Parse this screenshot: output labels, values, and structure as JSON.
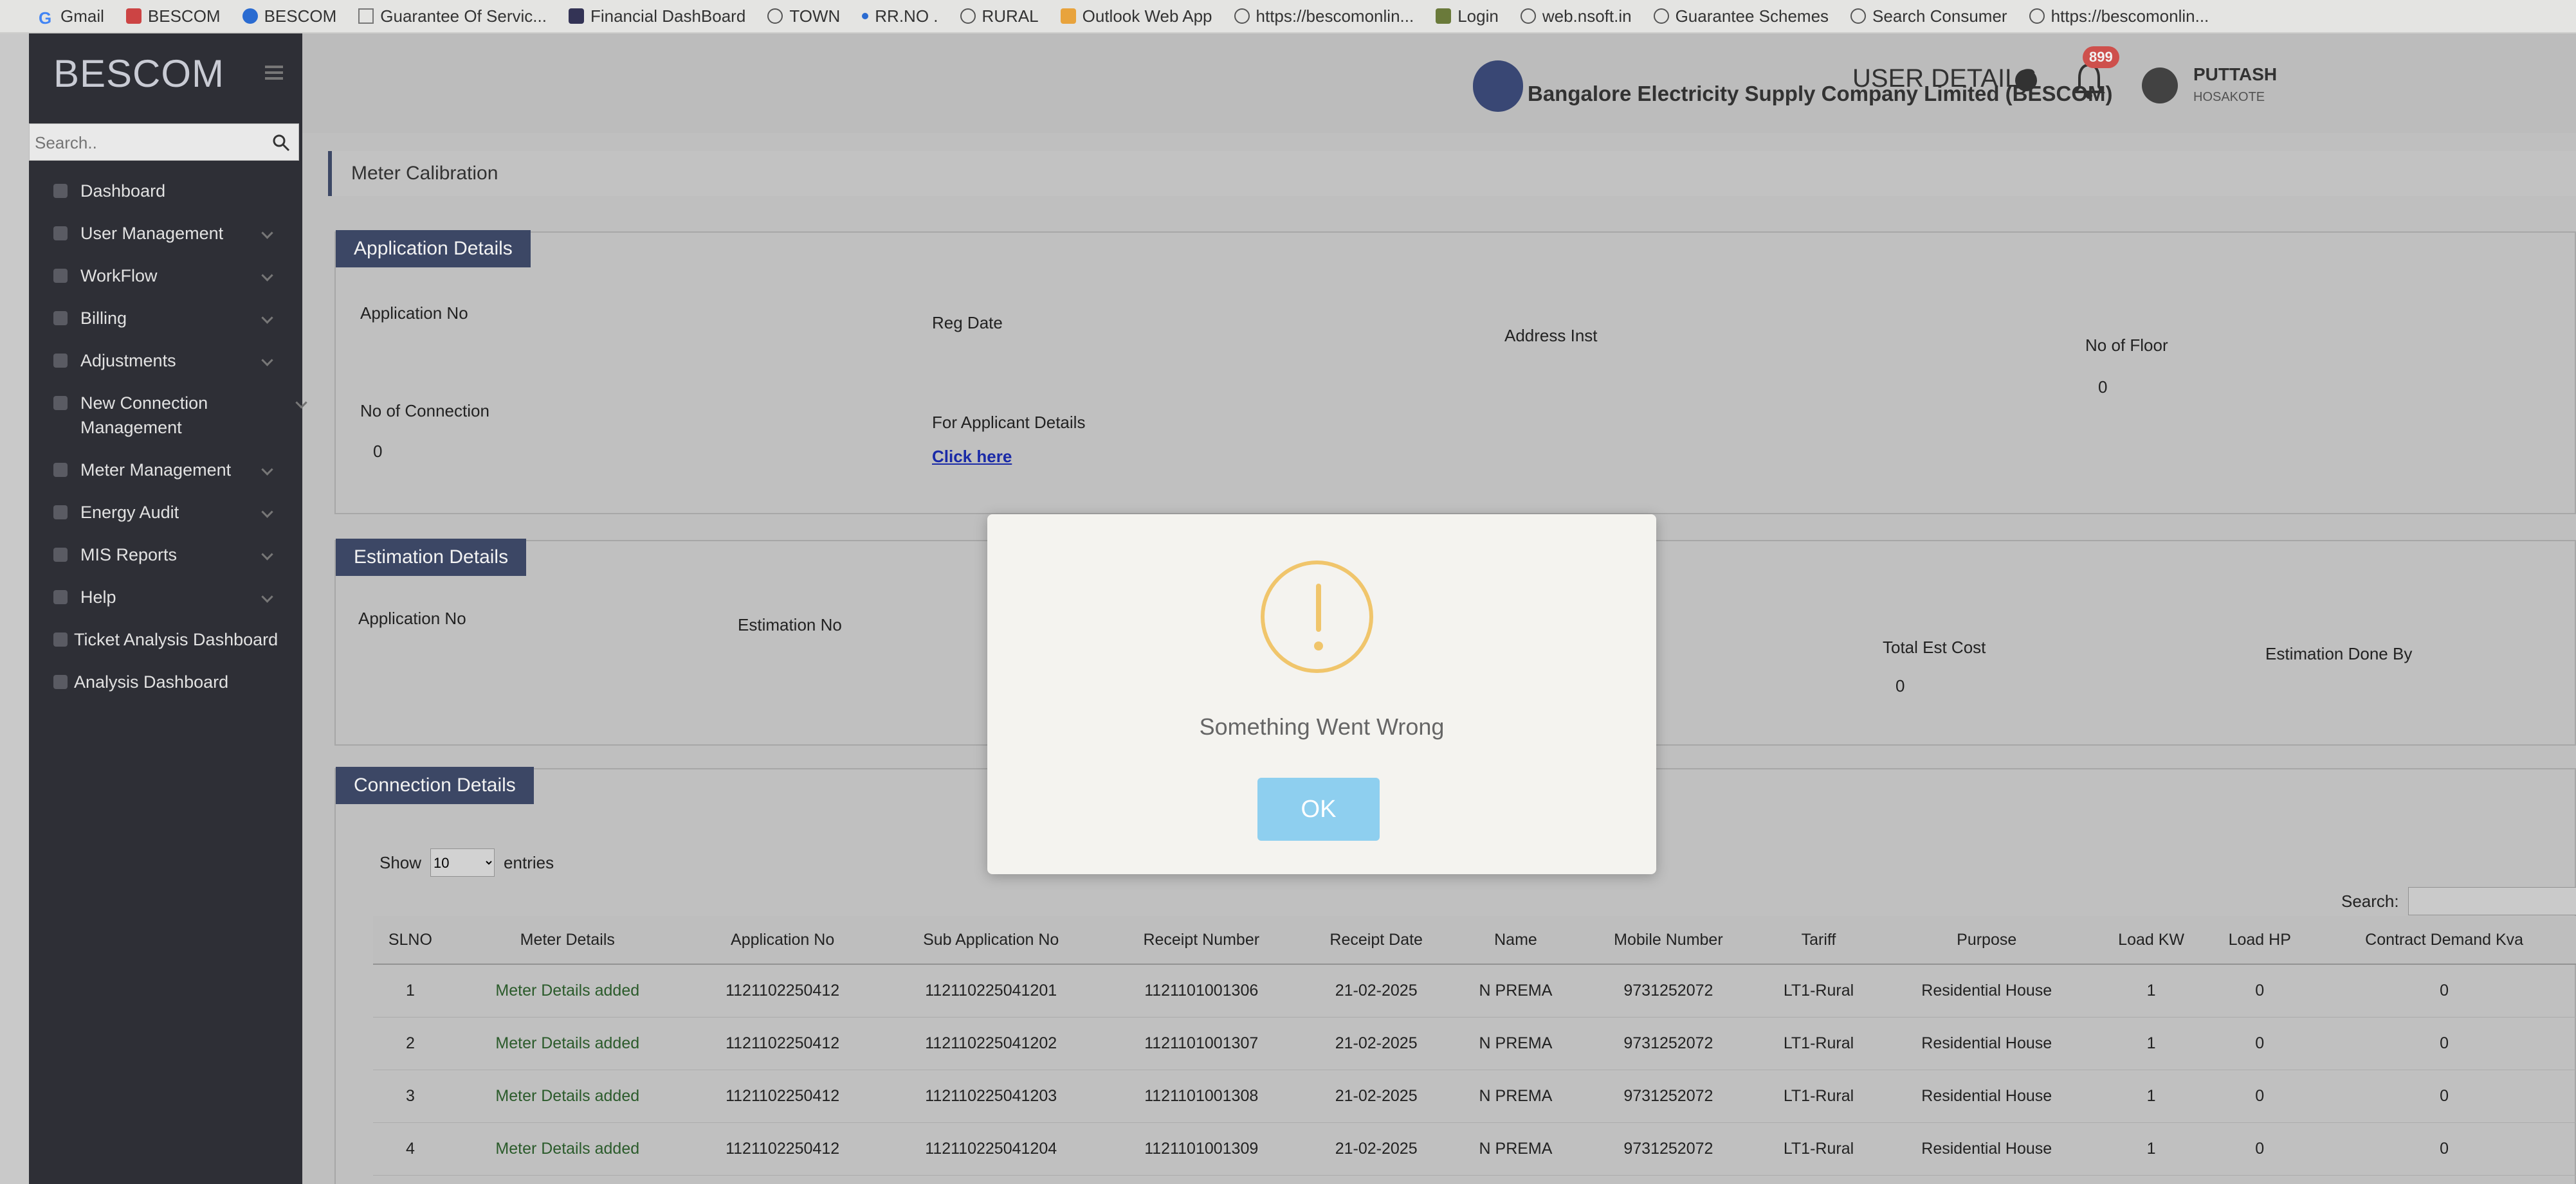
{
  "bookmarks": [
    "Gmail",
    "BESCOM",
    "BESCOM",
    "Guarantee Of Servic...",
    "Financial DashBoard",
    "TOWN",
    "RR.NO .",
    "RURAL",
    "Outlook Web App",
    "https://bescomonlin...",
    "Login",
    "web.nsoft.in",
    "Guarantee Schemes",
    "Search Consumer",
    "https://bescomonlin..."
  ],
  "sidebar": {
    "brand": "BESCOM",
    "search_placeholder": "Search..",
    "items": [
      {
        "label": "Dashboard"
      },
      {
        "label": "User Management"
      },
      {
        "label": "WorkFlow"
      },
      {
        "label": "Billing"
      },
      {
        "label": "Adjustments"
      },
      {
        "label": "New Connection Management"
      },
      {
        "label": "Meter Management"
      },
      {
        "label": "Energy Audit"
      },
      {
        "label": "MIS Reports"
      },
      {
        "label": "Help"
      },
      {
        "label": "Ticket Analysis Dashboard"
      },
      {
        "label": "Analysis Dashboard"
      }
    ]
  },
  "header": {
    "company": "Bangalore Electricity Supply Company Limited (BESCOM)",
    "user_details": "USER DETAILS",
    "notifications": "899",
    "user_name": "PUTTASH",
    "user_location": "HOSAKOTE"
  },
  "breadcrumb": "Meter Calibration",
  "application": {
    "title": "Application Details",
    "application_no_label": "Application No",
    "reg_date_label": "Reg Date",
    "address_label": "Address Inst",
    "floors_label": "No of Floor",
    "floors_value": "0",
    "connections_label": "No of Connection",
    "connections_value": "0",
    "applicant_label": "For Applicant Details",
    "click_here": "Click here"
  },
  "estimation": {
    "title": "Estimation Details",
    "application_no_label": "Application No",
    "estimation_no_label": "Estimation No",
    "total_cost_label": "Total Est Cost",
    "total_cost_value": "0",
    "done_by_label": "Estimation Done By"
  },
  "connection": {
    "title": "Connection Details",
    "show_label": "Show",
    "show_value": "10",
    "entries_label": "entries",
    "search_label": "Search:",
    "columns": [
      "SLNO",
      "Meter Details",
      "Application No",
      "Sub Application No",
      "Receipt Number",
      "Receipt Date",
      "Name",
      "Mobile Number",
      "Tariff",
      "Purpose",
      "Load KW",
      "Load HP",
      "Contract Demand Kva"
    ],
    "rows": [
      [
        "1",
        "Meter Details added",
        "1121102250412",
        "112110225041201",
        "1121101001306",
        "21-02-2025",
        "N PREMA",
        "9731252072",
        "LT1-Rural",
        "Residential House",
        "1",
        "0",
        "0"
      ],
      [
        "2",
        "Meter Details added",
        "1121102250412",
        "112110225041202",
        "1121101001307",
        "21-02-2025",
        "N PREMA",
        "9731252072",
        "LT1-Rural",
        "Residential House",
        "1",
        "0",
        "0"
      ],
      [
        "3",
        "Meter Details added",
        "1121102250412",
        "112110225041203",
        "1121101001308",
        "21-02-2025",
        "N PREMA",
        "9731252072",
        "LT1-Rural",
        "Residential House",
        "1",
        "0",
        "0"
      ],
      [
        "4",
        "Meter Details added",
        "1121102250412",
        "112110225041204",
        "1121101001309",
        "21-02-2025",
        "N PREMA",
        "9731252072",
        "LT1-Rural",
        "Residential House",
        "1",
        "0",
        "0"
      ]
    ]
  },
  "modal": {
    "message": "Something Went Wrong",
    "ok_label": "OK"
  },
  "colors": {
    "sidebar_bg": "#2e2f36",
    "section_header": "#3e4a6a",
    "warning": "#f0c56b",
    "ok_button": "#8ecfef"
  }
}
